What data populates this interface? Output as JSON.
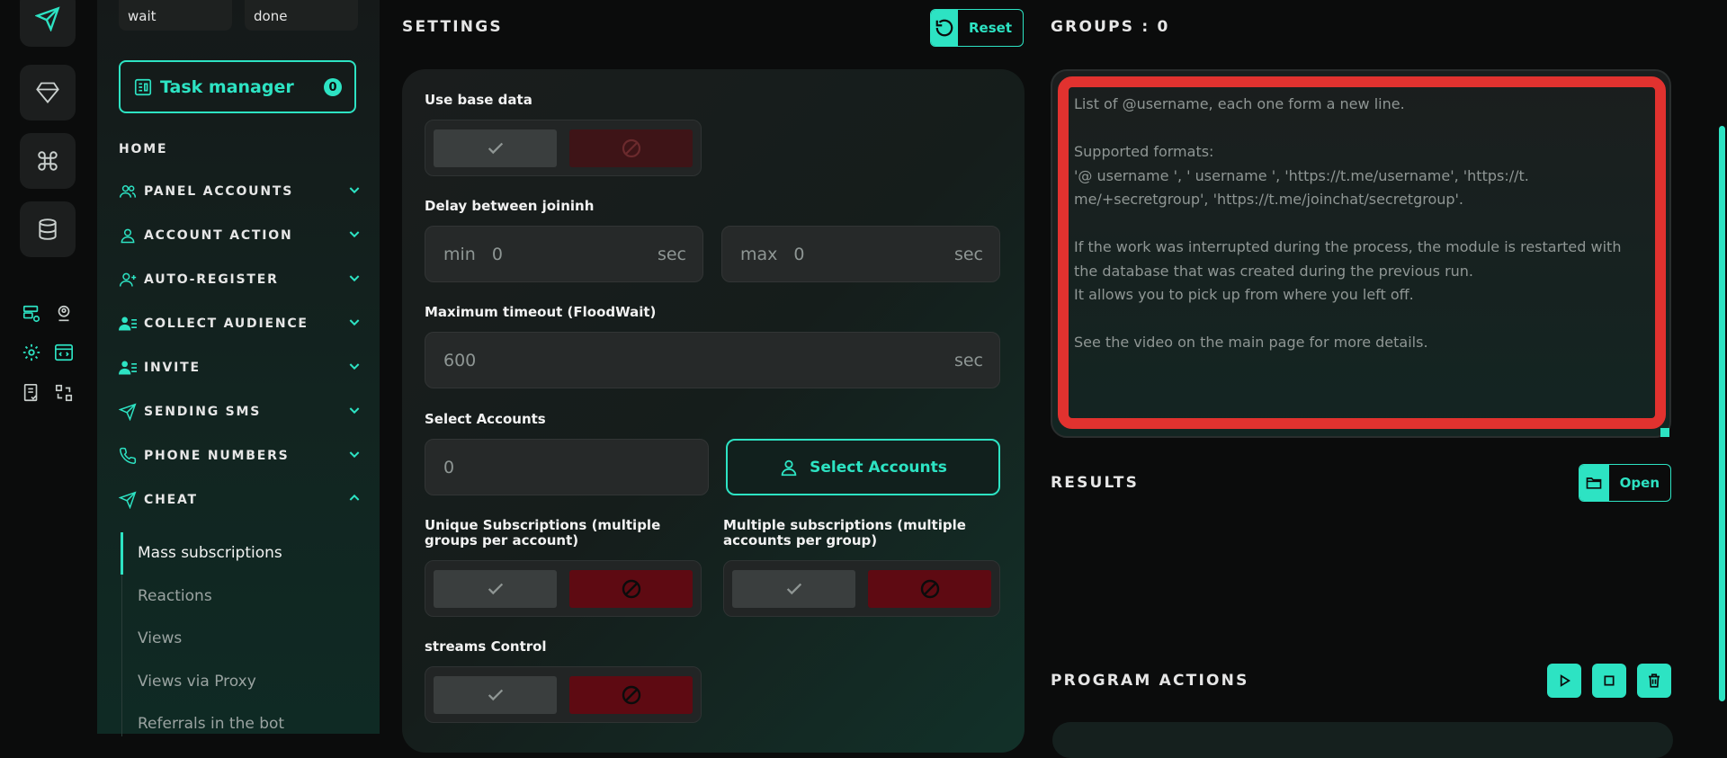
{
  "sidebar": {
    "status_pills": [
      "wait",
      "done"
    ],
    "task_manager": {
      "label": "Task manager",
      "count": "0"
    },
    "home_label": "HOME",
    "nav_items": [
      {
        "label": "PANEL ACCOUNTS",
        "icon": "users-icon"
      },
      {
        "label": "ACCOUNT ACTION",
        "icon": "user-icon"
      },
      {
        "label": "AUTO-REGISTER",
        "icon": "user-plus-icon"
      },
      {
        "label": "COLLECT AUDIENCE",
        "icon": "user-list-icon"
      },
      {
        "label": "INVITE",
        "icon": "user-list-icon"
      },
      {
        "label": "SENDING SMS",
        "icon": "send-icon"
      },
      {
        "label": "PHONE NUMBERS",
        "icon": "phone-icon"
      },
      {
        "label": "CHEAT",
        "icon": "send-bolt-icon"
      }
    ],
    "cheat_sub_items": [
      "Mass subscriptions",
      "Reactions",
      "Views",
      "Views via Proxy",
      "Referrals in the bot"
    ]
  },
  "settings": {
    "title": "SETTINGS",
    "reset_label": "Reset",
    "use_base_data_label": "Use base data",
    "delay_label": "Delay between joininh",
    "delay_min": {
      "prefix": "min",
      "value": "0",
      "unit": "sec"
    },
    "delay_max": {
      "prefix": "max",
      "value": "0",
      "unit": "sec"
    },
    "timeout_label": "Maximum timeout (FloodWait)",
    "timeout": {
      "value": "600",
      "unit": "sec"
    },
    "select_accounts_label": "Select Accounts",
    "accounts_count": "0",
    "select_accounts_button": "Select Accounts",
    "unique_subs_label": "Unique Subscriptions (multiple groups per account)",
    "multiple_subs_label": "Multiple subscriptions (multiple accounts per group)",
    "streams_label": "streams Control"
  },
  "groups": {
    "title": "GROUPS : 0",
    "placeholder": "List of @username, each one form a new line.\n\nSupported formats:\n'@ username ', ' username ', 'https://t.me/username', 'https://t. me/+secretgroup', 'https://t.me/joinchat/secretgroup'.\n\nIf the work was interrupted during the process, the module is restarted with the database that was created during the previous run.\nIt allows you to pick up from where you left off.\n\nSee the video on the main page for more details."
  },
  "results": {
    "title": "RESULTS",
    "open_label": "Open"
  },
  "program_actions": {
    "title": "PROGRAM ACTIONS"
  },
  "colors": {
    "accent": "#2de3c3",
    "danger": "#5e0a12",
    "highlight": "#e1322f"
  }
}
